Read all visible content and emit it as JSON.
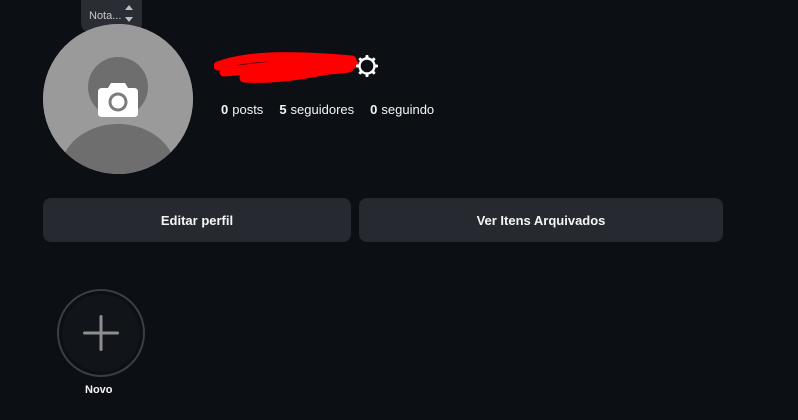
{
  "note": {
    "placeholder": "Nota..."
  },
  "profile": {
    "username": ""
  },
  "stats": {
    "posts": {
      "count": "0",
      "label": "posts"
    },
    "followers": {
      "count": "5",
      "label": "seguidores"
    },
    "following": {
      "count": "0",
      "label": "seguindo"
    }
  },
  "buttons": {
    "edit_profile": "Editar perfil",
    "view_archived": "Ver Itens Arquivados"
  },
  "highlights": {
    "new_label": "Novo"
  },
  "colors": {
    "background": "#0c0f14",
    "button_bg": "#262930",
    "redaction": "#ff0000",
    "text": "#f5f5f5"
  },
  "icons": {
    "settings": "gear-icon",
    "camera": "camera-icon",
    "plus": "plus-icon"
  }
}
